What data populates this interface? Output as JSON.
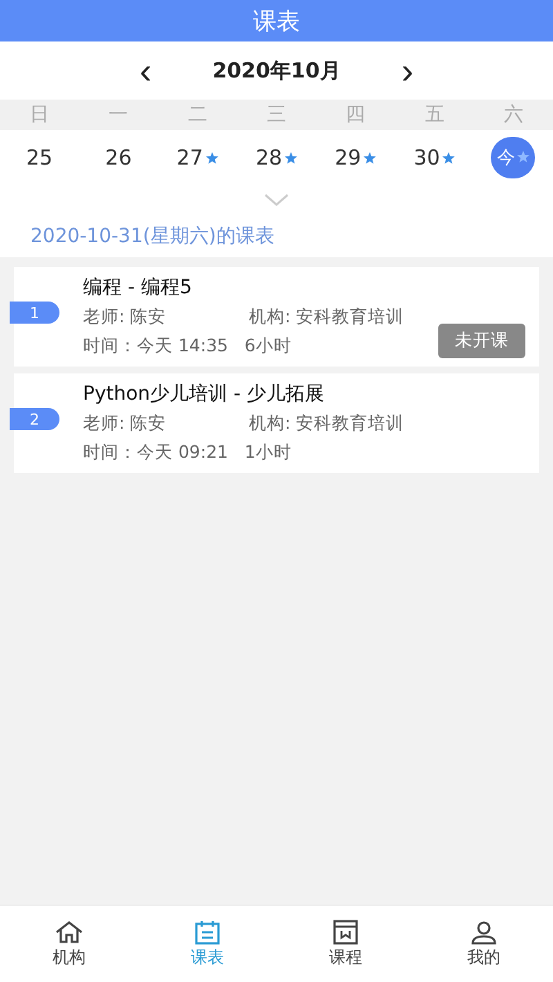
{
  "header": {
    "title": "课表"
  },
  "month_nav": {
    "prev": "‹",
    "label": "2020年10月",
    "next": "›"
  },
  "weekdays": [
    "日",
    "一",
    "二",
    "三",
    "四",
    "五",
    "六"
  ],
  "days": [
    {
      "label": "25",
      "marked": false,
      "selected": false
    },
    {
      "label": "26",
      "marked": false,
      "selected": false
    },
    {
      "label": "27",
      "marked": true,
      "selected": false
    },
    {
      "label": "28",
      "marked": true,
      "selected": false
    },
    {
      "label": "29",
      "marked": true,
      "selected": false
    },
    {
      "label": "30",
      "marked": true,
      "selected": false
    },
    {
      "label": "今",
      "marked": true,
      "selected": true
    }
  ],
  "schedule_title": "2020-10-31(星期六)的课表",
  "lessons": [
    {
      "index": "1",
      "title": "编程 - 编程5",
      "teacher": "老师: 陈安",
      "org": "机构: 安科教育培训",
      "time": "时间：今天 14:35   6小时",
      "status": "未开课"
    },
    {
      "index": "2",
      "title": "Python少儿培训 - 少儿拓展",
      "teacher": "老师: 陈安",
      "org": "机构: 安科教育培训",
      "time": "时间：今天 09:21   1小时"
    }
  ],
  "tabs": [
    {
      "label": "机构",
      "kind": "home",
      "selected": false
    },
    {
      "label": "课表",
      "kind": "schedule",
      "selected": true
    },
    {
      "label": "课程",
      "kind": "course",
      "selected": false
    },
    {
      "label": "我的",
      "kind": "profile",
      "selected": false
    }
  ]
}
